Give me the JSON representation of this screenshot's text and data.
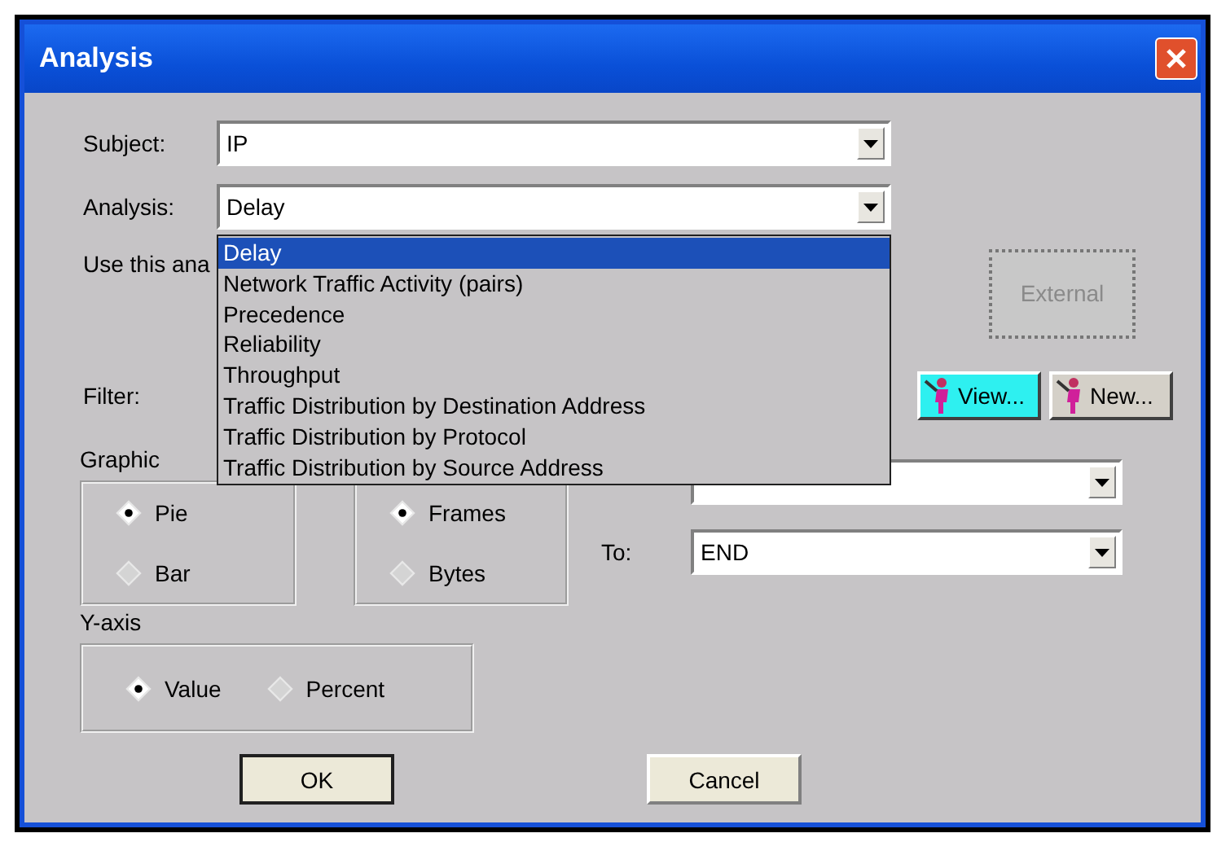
{
  "window": {
    "title": "Analysis"
  },
  "subject": {
    "label": "Subject:",
    "value": "IP"
  },
  "analysis": {
    "label": "Analysis:",
    "value": "Delay",
    "expanded": true,
    "options": [
      {
        "label": "Delay",
        "selected": true
      },
      {
        "label": "Network Traffic Activity (pairs)",
        "selected": false
      },
      {
        "label": "Precedence",
        "selected": false
      },
      {
        "label": "Reliability",
        "selected": false
      },
      {
        "label": "Throughput",
        "selected": false
      },
      {
        "label": "Traffic Distribution by Destination Address",
        "selected": false
      },
      {
        "label": "Traffic Distribution by Protocol",
        "selected": false
      },
      {
        "label": "Traffic Distribution by Source Address",
        "selected": false
      }
    ]
  },
  "use_text": "Use this ana",
  "external_button": {
    "label": "External",
    "disabled": true
  },
  "filter": {
    "label": "Filter:",
    "buttons": [
      {
        "label": "View...",
        "highlighted": true
      },
      {
        "label": "New...",
        "highlighted": false
      }
    ]
  },
  "graphic": {
    "label": "Graphic",
    "options": [
      {
        "label": "Pie",
        "selected": true
      },
      {
        "label": "Bar",
        "selected": false
      }
    ]
  },
  "units": {
    "options": [
      {
        "label": "Frames",
        "selected": true
      },
      {
        "label": "Bytes",
        "selected": false
      }
    ]
  },
  "to": {
    "label": "To:",
    "value": "END"
  },
  "y_axis": {
    "label": "Y-axis",
    "options": [
      {
        "label": "Value",
        "selected": true
      },
      {
        "label": "Percent",
        "selected": false
      }
    ]
  },
  "buttons": [
    {
      "label": "OK",
      "default": true
    },
    {
      "label": "Cancel",
      "default": false
    }
  ]
}
